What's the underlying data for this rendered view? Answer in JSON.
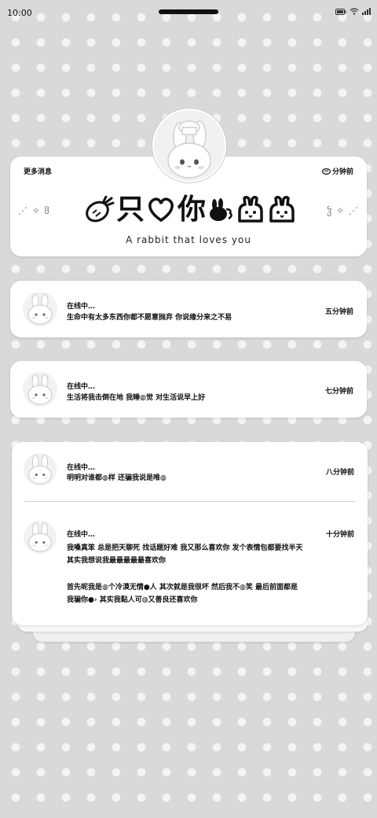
{
  "status_bar": {
    "time": "10:00"
  },
  "profile": {
    "more_label": "更多消息",
    "time": "分钟前",
    "title_chars": [
      "只",
      "你"
    ],
    "subtitle": "A rabbit that loves you",
    "deco_left": "⋰ ✧ ჱ",
    "deco_right": "ჴ ✧ ⋰"
  },
  "messages": [
    {
      "name": "在线中…",
      "text": "生命中有太多东西你都不愿意抛弃 你说缘分来之不易",
      "time": "五分钟前"
    },
    {
      "name": "在线中…",
      "text": "生活将我击倒在地 我睡◍觉 对生活说早上好",
      "time": "七分钟前"
    }
  ],
  "grouped": [
    {
      "name": "在线中…",
      "lines": [
        "明明对谁都◍样 还骗我说是唯◍"
      ],
      "time": "八分钟前"
    },
    {
      "name": "在线中…",
      "lines": [
        "我嗓真笨 总是把天聊死 找话题好难 我又那么喜欢你 发个表情包都要找半天",
        "其实我想说我最最最最最喜欢你",
        "",
        "首先呢我是◍个冷漠无情●人 其次就是我很坏 然后我不◍笑 最后前面都是",
        "我骗你●› 其实我黏人可◍又善良还喜欢你"
      ],
      "time": "十分钟前"
    }
  ]
}
